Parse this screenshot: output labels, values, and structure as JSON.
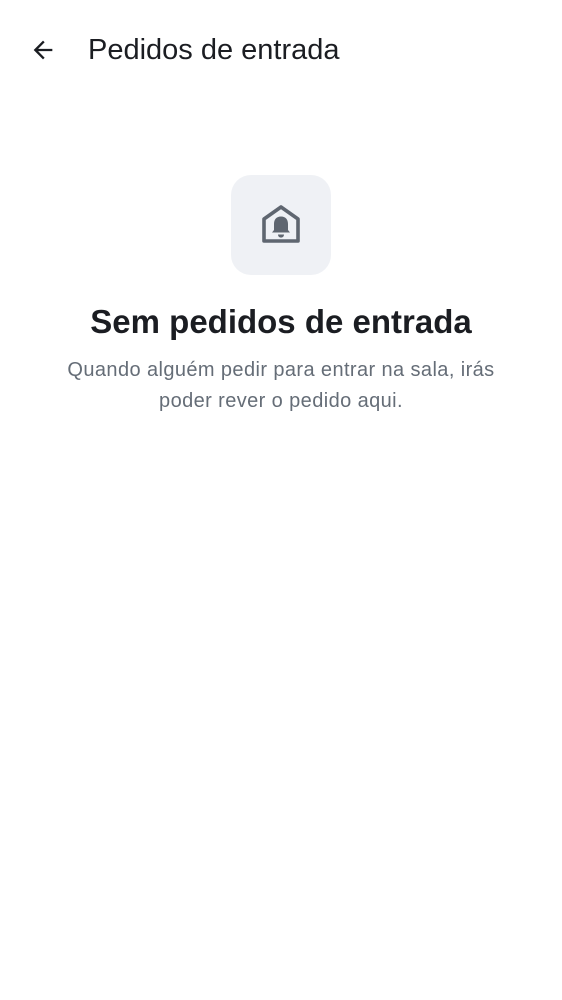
{
  "header": {
    "back_icon": "arrow-left-icon",
    "title": "Pedidos de entrada"
  },
  "empty_state": {
    "icon": "house-bell-icon",
    "title": "Sem pedidos de entrada",
    "description": "Quando alguém pedir para entrar na sala, irás poder rever o pedido aqui."
  },
  "colors": {
    "text_primary": "#1b1d22",
    "text_secondary": "#656d77",
    "icon_tile_background": "#eff1f5",
    "icon_color": "#5f6670"
  }
}
